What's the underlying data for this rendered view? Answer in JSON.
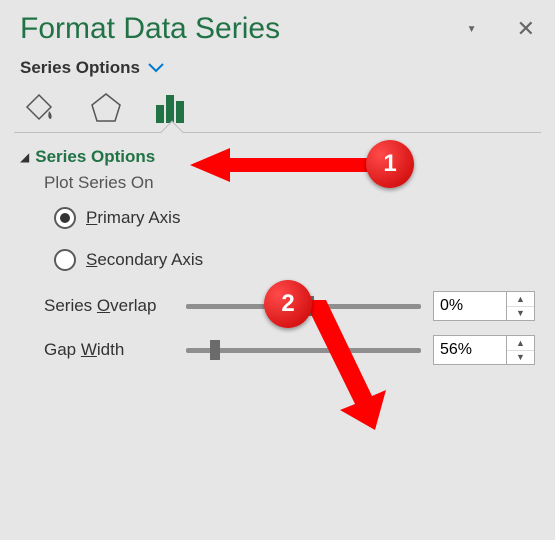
{
  "panel": {
    "title": "Format Data Series",
    "section_label": "Series Options"
  },
  "group": {
    "title": "Series Options",
    "plot_label": "Plot Series On",
    "radio_primary_pre": "P",
    "radio_primary_rest": "rimary Axis",
    "radio_secondary_pre": "S",
    "radio_secondary_rest": "econdary Axis",
    "overlap_label_pre": "Series ",
    "overlap_under": "O",
    "overlap_label_post": "verlap",
    "gap_label_pre": "Gap ",
    "gap_under": "W",
    "gap_label_post": "idth",
    "overlap_value": "0%",
    "gap_value": "56%"
  },
  "callouts": {
    "one": "1",
    "two": "2"
  }
}
